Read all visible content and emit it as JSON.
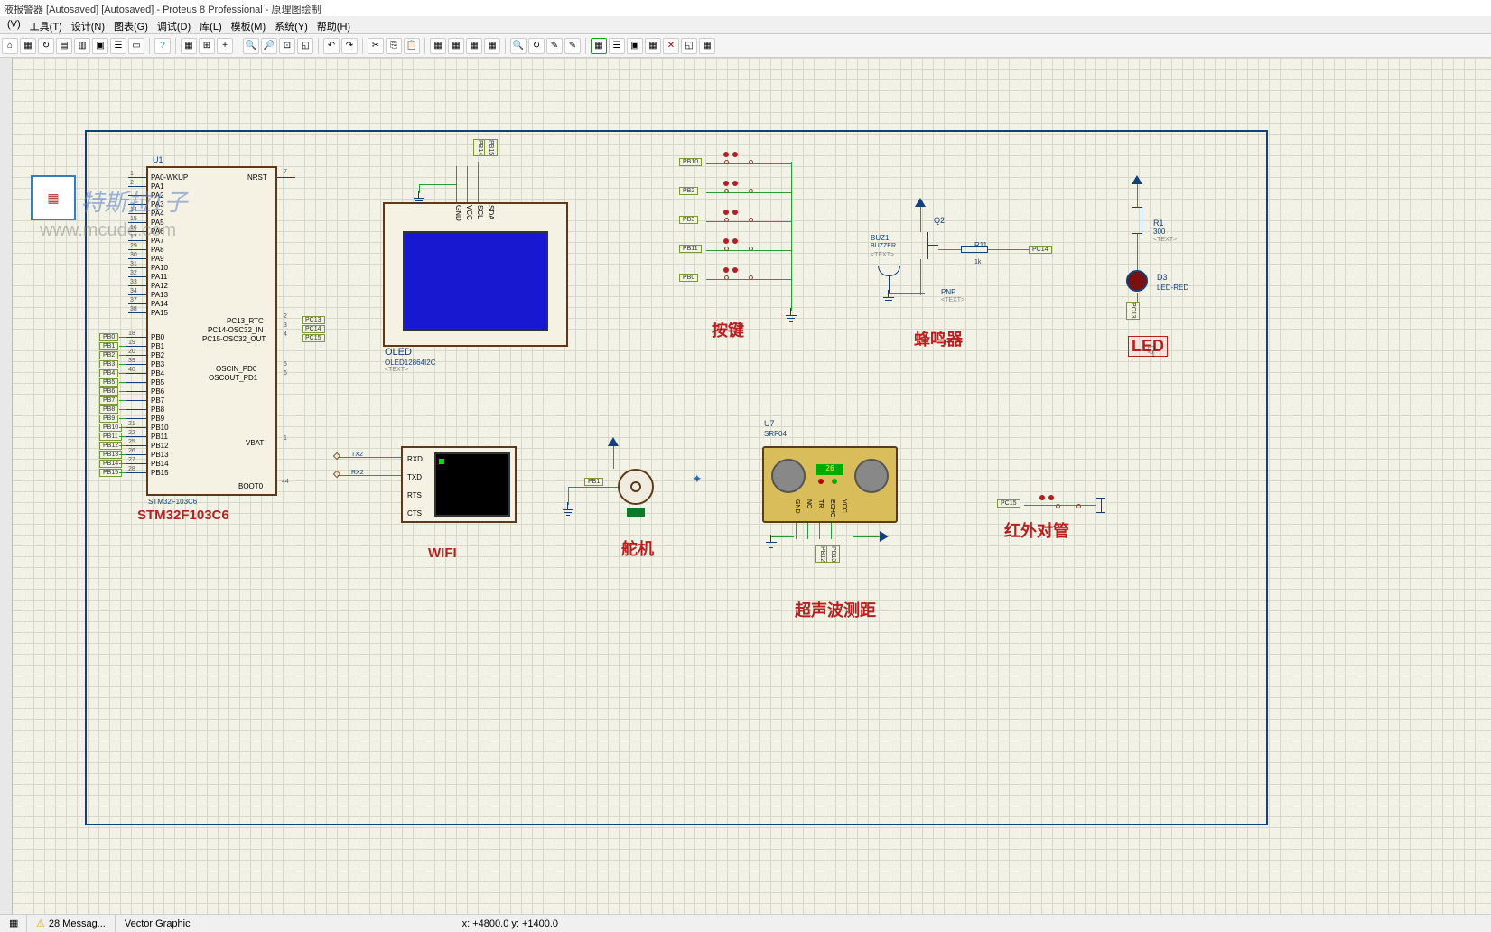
{
  "title": "液报警器 [Autosaved]  [Autosaved] - Proteus 8 Professional - 原理图绘制",
  "menu": [
    "(V)",
    "工具(T)",
    "设计(N)",
    "图表(G)",
    "调试(D)",
    "库(L)",
    "模板(M)",
    "系统(Y)",
    "帮助(H)"
  ],
  "watermark1": "特斯拉1子",
  "watermark2": "www.mcude.com",
  "mcu": {
    "ref": "U1",
    "part": "STM32F103C6",
    "footprint": "STM32F103C6",
    "left_pins": [
      {
        "num": "1",
        "name": "PA0-WKUP"
      },
      {
        "num": "2",
        "name": "PA1"
      },
      {
        "num": "",
        "name": "PA2"
      },
      {
        "num": "",
        "name": "PA3"
      },
      {
        "num": "14",
        "name": "PA4"
      },
      {
        "num": "15",
        "name": "PA5"
      },
      {
        "num": "16",
        "name": "PA6"
      },
      {
        "num": "17",
        "name": "PA7"
      },
      {
        "num": "29",
        "name": "PA8"
      },
      {
        "num": "30",
        "name": "PA9"
      },
      {
        "num": "31",
        "name": "PA10"
      },
      {
        "num": "32",
        "name": "PA11"
      },
      {
        "num": "33",
        "name": "PA12"
      },
      {
        "num": "34",
        "name": "PA13"
      },
      {
        "num": "37",
        "name": "PA14"
      },
      {
        "num": "38",
        "name": "PA15"
      }
    ],
    "left_pb": [
      {
        "net": "PB0",
        "num": "18",
        "name": "PB0"
      },
      {
        "net": "PB1",
        "num": "19",
        "name": "PB1"
      },
      {
        "net": "PB2",
        "num": "20",
        "name": "PB2"
      },
      {
        "net": "PB3",
        "num": "39",
        "name": "PB3"
      },
      {
        "net": "PB4",
        "num": "40",
        "name": "PB4"
      },
      {
        "net": "PB5",
        "num": "",
        "name": "PB5"
      },
      {
        "net": "PB6",
        "num": "",
        "name": "PB6"
      },
      {
        "net": "PB7",
        "num": "",
        "name": "PB7"
      },
      {
        "net": "PB8",
        "num": "",
        "name": "PB8"
      },
      {
        "net": "PB9",
        "num": "",
        "name": "PB9"
      },
      {
        "net": "PB10",
        "num": "21",
        "name": "PB10"
      },
      {
        "net": "PB11",
        "num": "22",
        "name": "PB11"
      },
      {
        "net": "PB12",
        "num": "25",
        "name": "PB12"
      },
      {
        "net": "PB13",
        "num": "26",
        "name": "PB13"
      },
      {
        "net": "PB14",
        "num": "27",
        "name": "PB14"
      },
      {
        "net": "PB15",
        "num": "28",
        "name": "PB15"
      }
    ],
    "right_pins": [
      {
        "name": "NRST",
        "num": "7"
      },
      {
        "name": "PC13_RTC",
        "num": "2",
        "net": "PC13"
      },
      {
        "name": "PC14-OSC32_IN",
        "num": "3",
        "net": "PC14"
      },
      {
        "name": "PC15-OSC32_OUT",
        "num": "4",
        "net": "PC15"
      },
      {
        "name": "OSCIN_PD0",
        "num": "5"
      },
      {
        "name": "OSCOUT_PD1",
        "num": "6"
      },
      {
        "name": "VBAT",
        "num": "1"
      },
      {
        "name": "BOOT0",
        "num": "44"
      }
    ]
  },
  "oled": {
    "ref": "OLED",
    "part": "OLED12864I2C",
    "pins": [
      "GND",
      "VCC",
      "SCL",
      "SDA"
    ],
    "nets": [
      "",
      "",
      "PB14",
      "PB15"
    ]
  },
  "wifi": {
    "label": "WIFI",
    "pins": [
      "RXD",
      "TXD",
      "RTS",
      "CTS"
    ],
    "tx": "TX2",
    "rx": "RX2"
  },
  "buttons": {
    "label": "按键",
    "nets": [
      "PB10",
      "PB2",
      "PB3",
      "PB11",
      "PB0"
    ]
  },
  "buzzer": {
    "label": "蜂鸣器",
    "ref": "BUZ1",
    "part": "BUZZER",
    "q": "Q2",
    "qtype": "PNP",
    "r": "R11",
    "rval": "1k",
    "net": "PC14"
  },
  "led": {
    "label": "LED",
    "r": "R1",
    "rval": "300",
    "d": "D3",
    "dpart": "LED-RED",
    "net": "PC13"
  },
  "servo": {
    "label": "舵机",
    "net": "PB1"
  },
  "ultrasonic": {
    "label": "超声波测距",
    "ref": "U7",
    "part": "SRF04",
    "value": "26",
    "pins": [
      "GND",
      "NC",
      "TR",
      "ECHO",
      "VCC"
    ],
    "nets": [
      "PB12",
      "PB13"
    ]
  },
  "ir": {
    "label": "红外对管",
    "net": "PC15"
  },
  "status": {
    "messages": "28 Messag...",
    "mode": "Vector Graphic",
    "coords": "x:    +4800.0  y:    +1400.0"
  }
}
